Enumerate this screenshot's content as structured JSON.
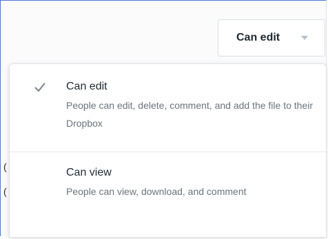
{
  "permission_button": {
    "label": "Can edit",
    "icon": "chevron-down-icon"
  },
  "menu": {
    "items": [
      {
        "title": "Can edit",
        "description": "People can edit, delete, comment, and add the file to their Dropbox",
        "selected": true,
        "icon": "check-icon"
      },
      {
        "title": "Can view",
        "description": "People can view, download, and comment",
        "selected": false
      }
    ]
  },
  "colors": {
    "text": "#1f2933",
    "muted": "#6a737d",
    "border": "#dfe3e8",
    "frame_accent": "#4a7bd0"
  }
}
